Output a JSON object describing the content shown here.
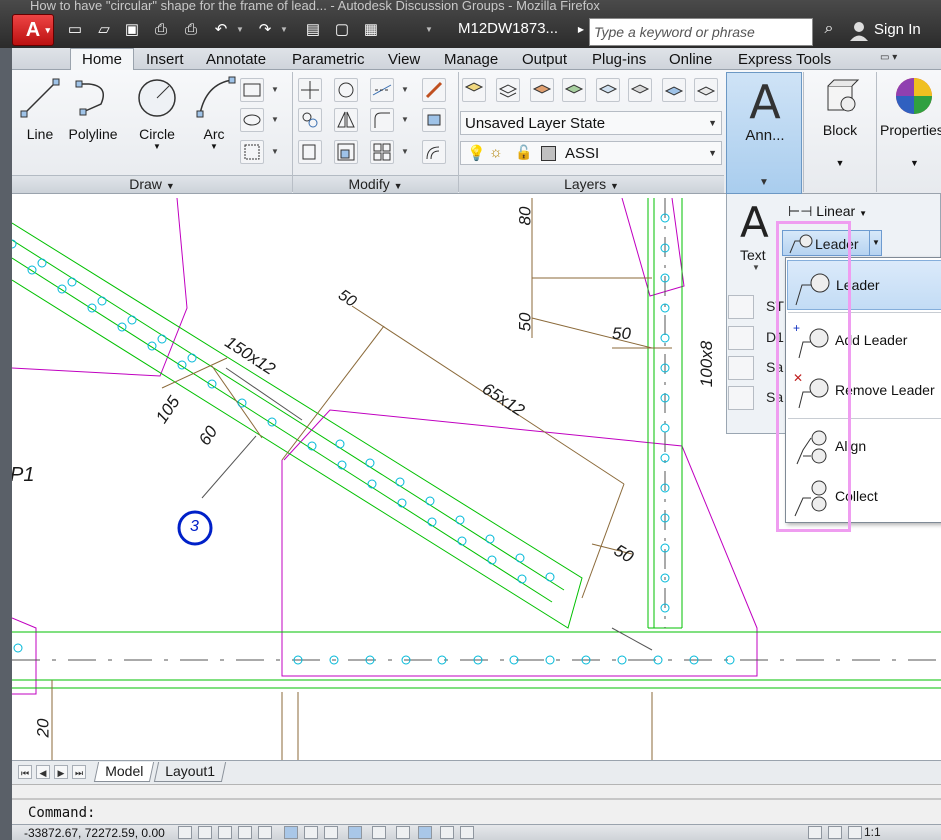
{
  "window": {
    "firefox_title": "How to have \"circular\" shape for the frame of lead... - Autodesk Discussion Groups - Mozilla Firefox",
    "drawing_title": "M12DW1873...",
    "search_placeholder": "Type a keyword or phrase",
    "sign_in": "Sign In"
  },
  "tabs": [
    "Home",
    "Insert",
    "Annotate",
    "Parametric",
    "View",
    "Manage",
    "Output",
    "Plug-ins",
    "Online",
    "Express Tools"
  ],
  "ribbon": {
    "draw": {
      "title": "Draw",
      "tools": [
        "Line",
        "Polyline",
        "Circle",
        "Arc"
      ]
    },
    "modify": {
      "title": "Modify"
    },
    "layers": {
      "title": "Layers",
      "layer_state": "Unsaved Layer State",
      "current_layer": "ASSI"
    },
    "annotation": {
      "label": "Ann..."
    },
    "block": {
      "label": "Block"
    },
    "properties": {
      "label": "Properties"
    }
  },
  "annotation_panel": {
    "text_label": "Text",
    "linear_label": "Linear",
    "leader_label": "Leader",
    "side_tools": [
      "ST",
      "D1",
      "Sa",
      "Sa"
    ]
  },
  "leader_menu": {
    "items": [
      {
        "label": "Leader",
        "icon": "leader-icon"
      },
      {
        "label": "Add Leader",
        "icon": "add-leader-icon"
      },
      {
        "label": "Remove Leader",
        "icon": "remove-leader-icon"
      },
      {
        "label": "Align",
        "icon": "align-leaders-icon"
      },
      {
        "label": "Collect",
        "icon": "collect-leaders-icon"
      }
    ]
  },
  "drawing": {
    "dims": {
      "d50_top": "50",
      "d150x12": "150x12",
      "d105": "105",
      "d60": "60",
      "d65x12": "65x12",
      "d50_right": "50",
      "d50_vert": "50",
      "d80": "80",
      "d100x8": "100x8",
      "d50_low": "50",
      "d20": "20",
      "p1": "P1",
      "mark3": "3"
    }
  },
  "layouts": [
    "Model",
    "Layout1"
  ],
  "command": {
    "prompt": "Command:"
  },
  "status": {
    "coords": "-33872.67, 72272.59, 0.00",
    "scale": "1:1"
  },
  "colors": {
    "accent": "#b6d3f1",
    "highlight_box": "#ef9df0",
    "magenta": "#c000c0",
    "green": "#00c000",
    "cyan": "#00b8d8",
    "brown": "#8b6a3a"
  }
}
